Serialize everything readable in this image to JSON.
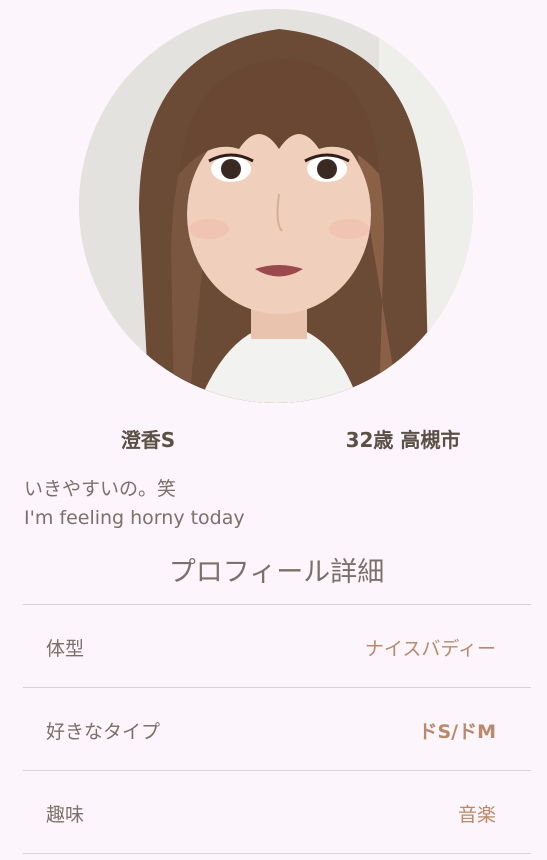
{
  "profile": {
    "name": "澄香S",
    "age_city": "32歳 高槻市",
    "bio_line1": "いきやすいの。笑",
    "bio_line2": "I'm feeling horny today"
  },
  "details": {
    "title": "プロフィール詳細",
    "rows": [
      {
        "label": "体型",
        "value": "ナイスバディー"
      },
      {
        "label": "好きなタイプ",
        "value": "ドS/ドM"
      },
      {
        "label": "趣味",
        "value": "音楽"
      }
    ]
  },
  "colors": {
    "background": "#fcf5fb",
    "text_primary": "#5b5046",
    "text_secondary": "#7a716a",
    "accent_value": "#b9896a",
    "divider": "#d9d3d6"
  }
}
